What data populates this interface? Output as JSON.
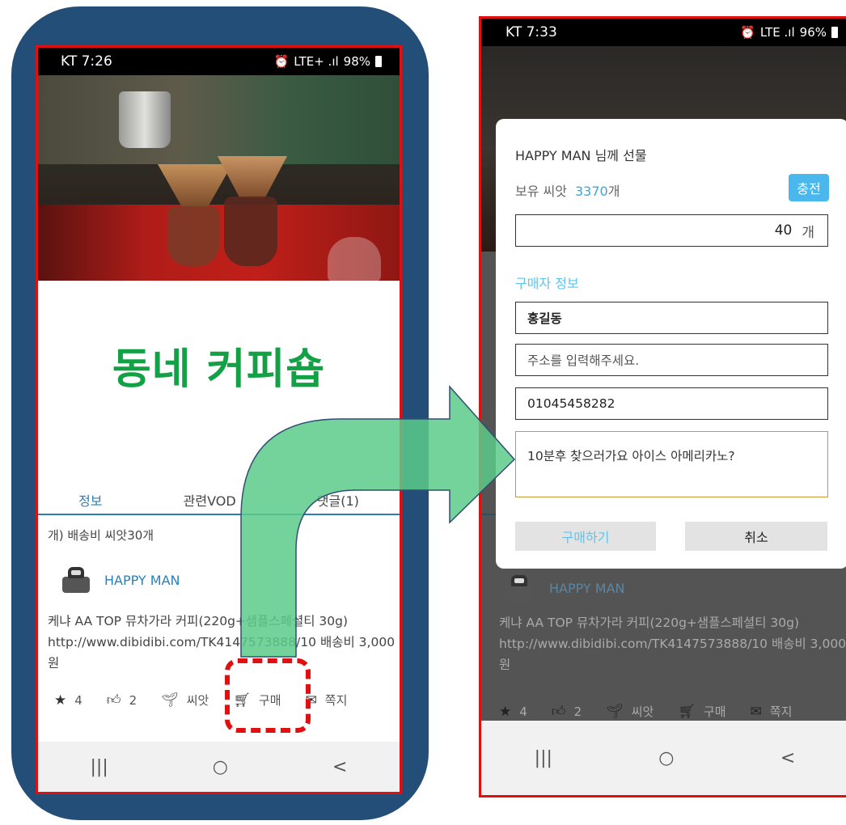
{
  "left_screen": {
    "status": {
      "carrier_time": "KT 7:26",
      "indicators": "LTE+ .ıl",
      "battery": "98%"
    },
    "shop_title": "동네 커피숍",
    "title_color": "#13a146",
    "tabs": [
      "정보",
      "관련VOD",
      "댓글(1)"
    ],
    "post_desc": "개) 배송비 씨앗30개",
    "author": "HAPPY MAN",
    "post_body": "케냐 AA TOP 뮤차가라 커피(220g+샘플스페셜티 30g) http://www.dibidibi.com/TK4147573888/10 배송비 3,000원",
    "actions": {
      "star_count": "4",
      "like_count": "2",
      "seed_label": "씨앗",
      "buy_label": "구매",
      "message_label": "쪽지"
    },
    "nav": {
      "recent": "|||",
      "home": "○",
      "back": "<"
    }
  },
  "right_screen": {
    "status": {
      "carrier_time": "KT 7:33",
      "indicators": "LTE .ıl",
      "battery": "96%"
    },
    "modal": {
      "title": "HAPPY MAN 님께 선물",
      "seeds_label": "보유 씨앗",
      "seeds_value": "3370",
      "seeds_unit": "개",
      "charge_button": "충전",
      "quantity_value": "40",
      "quantity_unit": "개",
      "buyer_info_label": "구매자 정보",
      "name_value": "홍길동",
      "address_placeholder": "주소를 입력해주세요.",
      "phone_value": "01045458282",
      "memo_value": "10분후 찾으러가요  아이스 아메리카노?",
      "buy_button": "구매하기",
      "cancel_button": "취소"
    },
    "author": "HAPPY MAN",
    "post_body": "케냐 AA TOP 뮤차가라 커피(220g+샘플스페셜티 30g) http://www.dibidibi.com/TK4147573888/10 배송비 3,000원",
    "actions": {
      "star_count": "4",
      "like_count": "2",
      "seed_label": "씨앗",
      "buy_label": "구매",
      "message_label": "쪽지"
    },
    "nav": {
      "recent": "|||",
      "home": "○",
      "back": "<"
    }
  },
  "colors": {
    "accent_blue": "#2a7fb8",
    "charge_blue": "#4ab8ec",
    "highlight_red": "#e01010",
    "arrow_green": "#5ccb8a"
  }
}
